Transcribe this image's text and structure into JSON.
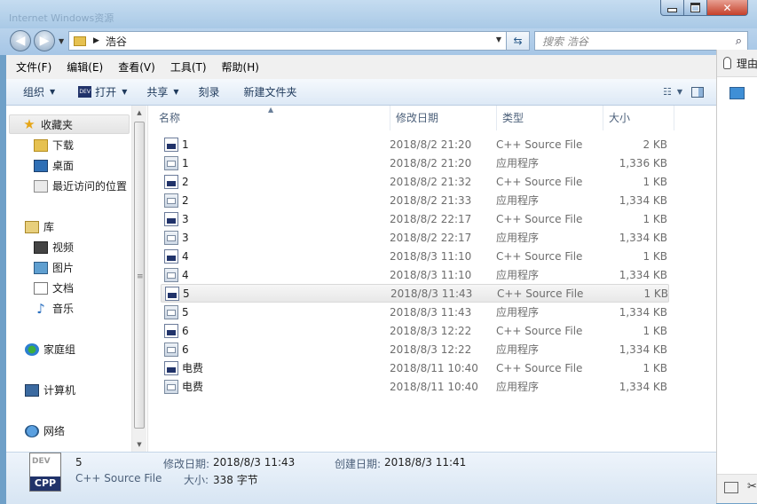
{
  "window": {
    "background_title_ghost": "Internet   Windows资源"
  },
  "nav": {
    "breadcrumb": "浩谷",
    "search_placeholder": "搜索 浩谷"
  },
  "menu": [
    "文件(F)",
    "编辑(E)",
    "查看(V)",
    "工具(T)",
    "帮助(H)"
  ],
  "toolbar": {
    "organize": "组织",
    "open": "打开",
    "share": "共享",
    "burn": "刻录",
    "new_folder": "新建文件夹"
  },
  "sidebar": {
    "favorites": "收藏夹",
    "downloads": "下载",
    "desktop": "桌面",
    "recent": "最近访问的位置",
    "libraries": "库",
    "videos": "视频",
    "pictures": "图片",
    "documents": "文档",
    "music": "音乐",
    "homegroup": "家庭组",
    "computer": "计算机",
    "network": "网络"
  },
  "columns": {
    "name": "名称",
    "modified": "修改日期",
    "type": "类型",
    "size": "大小"
  },
  "files": [
    {
      "name": "1",
      "date": "2018/8/2 21:20",
      "type": "C++ Source File",
      "size": "2 KB",
      "icon": "cpp"
    },
    {
      "name": "1",
      "date": "2018/8/2 21:20",
      "type": "应用程序",
      "size": "1,336 KB",
      "icon": "exe"
    },
    {
      "name": "2",
      "date": "2018/8/2 21:32",
      "type": "C++ Source File",
      "size": "1 KB",
      "icon": "cpp"
    },
    {
      "name": "2",
      "date": "2018/8/2 21:33",
      "type": "应用程序",
      "size": "1,334 KB",
      "icon": "exe"
    },
    {
      "name": "3",
      "date": "2018/8/2 22:17",
      "type": "C++ Source File",
      "size": "1 KB",
      "icon": "cpp"
    },
    {
      "name": "3",
      "date": "2018/8/2 22:17",
      "type": "应用程序",
      "size": "1,334 KB",
      "icon": "exe"
    },
    {
      "name": "4",
      "date": "2018/8/3 11:10",
      "type": "C++ Source File",
      "size": "1 KB",
      "icon": "cpp"
    },
    {
      "name": "4",
      "date": "2018/8/3 11:10",
      "type": "应用程序",
      "size": "1,334 KB",
      "icon": "exe"
    },
    {
      "name": "5",
      "date": "2018/8/3 11:43",
      "type": "C++ Source File",
      "size": "1 KB",
      "icon": "cpp",
      "selected": true
    },
    {
      "name": "5",
      "date": "2018/8/3 11:43",
      "type": "应用程序",
      "size": "1,334 KB",
      "icon": "exe"
    },
    {
      "name": "6",
      "date": "2018/8/3 12:22",
      "type": "C++ Source File",
      "size": "1 KB",
      "icon": "cpp"
    },
    {
      "name": "6",
      "date": "2018/8/3 12:22",
      "type": "应用程序",
      "size": "1,334 KB",
      "icon": "exe"
    },
    {
      "name": "电费",
      "date": "2018/8/11 10:40",
      "type": "C++ Source File",
      "size": "1 KB",
      "icon": "cpp"
    },
    {
      "name": "电费",
      "date": "2018/8/11 10:40",
      "type": "应用程序",
      "size": "1,334 KB",
      "icon": "exe"
    }
  ],
  "details": {
    "icon_top": "DEV",
    "icon_badge": "CPP",
    "name": "5",
    "type": "C++ Source File",
    "modified_label": "修改日期:",
    "modified_value": "2018/8/3 11:43",
    "created_label": "创建日期:",
    "created_value": "2018/8/3 11:41",
    "size_label": "大小:",
    "size_value": "338 字节"
  },
  "side_panel": {
    "top_text": "理由"
  },
  "colors": {
    "accent": "#1e395b",
    "selection": "#e8e8e8"
  }
}
